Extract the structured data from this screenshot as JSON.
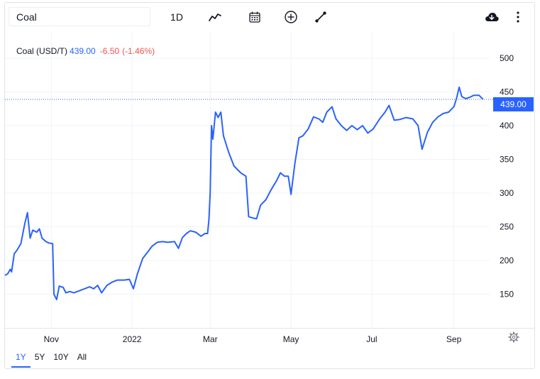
{
  "toolbar": {
    "symbol_value": "Coal",
    "interval_label": "1D",
    "icons": [
      "chart-type-icon",
      "calendar-icon",
      "add-indicator-icon",
      "draw-line-icon",
      "download-icon",
      "more-vertical-icon"
    ]
  },
  "legend": {
    "name": "Coal (USD/T)",
    "price": "439.00",
    "change": "-6.50",
    "change_pct": "(-1.46%)"
  },
  "price_tag": "439.00",
  "range_tabs": [
    {
      "label": "1Y",
      "active": true
    },
    {
      "label": "5Y",
      "active": false
    },
    {
      "label": "10Y",
      "active": false
    },
    {
      "label": "All",
      "active": false
    }
  ],
  "colors": {
    "line": "#2962ff",
    "down": "#ef5350",
    "grid": "#f0f3fa",
    "text": "#131722"
  },
  "chart_data": {
    "type": "line",
    "title": "",
    "xlabel": "",
    "ylabel": "",
    "ylim": [
      100,
      540
    ],
    "yticks": [
      150,
      200,
      250,
      300,
      350,
      400,
      450,
      500
    ],
    "xticks": [
      {
        "label": "Nov",
        "date": "2021-11-01"
      },
      {
        "label": "2022",
        "date": "2022-01-01"
      },
      {
        "label": "Mar",
        "date": "2022-03-01"
      },
      {
        "label": "May",
        "date": "2022-05-01"
      },
      {
        "label": "Jul",
        "date": "2022-07-01"
      },
      {
        "label": "Sep",
        "date": "2022-09-01"
      }
    ],
    "x_start": "2021-09-27",
    "x_end": "2022-09-28",
    "last_value": 439.0,
    "grid": true,
    "series": [
      {
        "values": [
          [
            "2021-09-27",
            178
          ],
          [
            "2021-09-29",
            180
          ],
          [
            "2021-10-01",
            187
          ],
          [
            "2021-10-02",
            183
          ],
          [
            "2021-10-04",
            210
          ],
          [
            "2021-10-06",
            215
          ],
          [
            "2021-10-09",
            225
          ],
          [
            "2021-10-12",
            255
          ],
          [
            "2021-10-14",
            271
          ],
          [
            "2021-10-16",
            233
          ],
          [
            "2021-10-18",
            245
          ],
          [
            "2021-10-21",
            242
          ],
          [
            "2021-10-23",
            247
          ],
          [
            "2021-10-25",
            233
          ],
          [
            "2021-10-28",
            228
          ],
          [
            "2021-10-30",
            226
          ],
          [
            "2021-11-02",
            225
          ],
          [
            "2021-11-03",
            150
          ],
          [
            "2021-11-05",
            142
          ],
          [
            "2021-11-07",
            162
          ],
          [
            "2021-11-10",
            160
          ],
          [
            "2021-11-12",
            152
          ],
          [
            "2021-11-15",
            154
          ],
          [
            "2021-11-18",
            152
          ],
          [
            "2021-11-22",
            155
          ],
          [
            "2021-11-26",
            158
          ],
          [
            "2021-11-30",
            161
          ],
          [
            "2021-12-03",
            158
          ],
          [
            "2021-12-06",
            163
          ],
          [
            "2021-12-09",
            152
          ],
          [
            "2021-12-13",
            163
          ],
          [
            "2021-12-17",
            168
          ],
          [
            "2021-12-21",
            171
          ],
          [
            "2021-12-26",
            171
          ],
          [
            "2021-12-30",
            172
          ],
          [
            "2022-01-02",
            158
          ],
          [
            "2022-01-05",
            180
          ],
          [
            "2022-01-09",
            203
          ],
          [
            "2022-01-13",
            213
          ],
          [
            "2022-01-16",
            221
          ],
          [
            "2022-01-20",
            227
          ],
          [
            "2022-01-24",
            228
          ],
          [
            "2022-01-28",
            227
          ],
          [
            "2022-02-02",
            228
          ],
          [
            "2022-02-05",
            218
          ],
          [
            "2022-02-08",
            234
          ],
          [
            "2022-02-11",
            240
          ],
          [
            "2022-02-14",
            244
          ],
          [
            "2022-02-18",
            242
          ],
          [
            "2022-02-22",
            236
          ],
          [
            "2022-02-25",
            240
          ],
          [
            "2022-02-27",
            240
          ],
          [
            "2022-02-28",
            260
          ],
          [
            "2022-03-01",
            300
          ],
          [
            "2022-03-02",
            400
          ],
          [
            "2022-03-03",
            380
          ],
          [
            "2022-03-05",
            420
          ],
          [
            "2022-03-07",
            412
          ],
          [
            "2022-03-09",
            420
          ],
          [
            "2022-03-11",
            385
          ],
          [
            "2022-03-15",
            360
          ],
          [
            "2022-03-19",
            340
          ],
          [
            "2022-03-24",
            330
          ],
          [
            "2022-03-28",
            325
          ],
          [
            "2022-03-30",
            265
          ],
          [
            "2022-04-02",
            263
          ],
          [
            "2022-04-05",
            262
          ],
          [
            "2022-04-08",
            282
          ],
          [
            "2022-04-12",
            290
          ],
          [
            "2022-04-16",
            305
          ],
          [
            "2022-04-20",
            318
          ],
          [
            "2022-04-23",
            330
          ],
          [
            "2022-04-26",
            325
          ],
          [
            "2022-04-29",
            325
          ],
          [
            "2022-05-01",
            298
          ],
          [
            "2022-05-04",
            345
          ],
          [
            "2022-05-07",
            382
          ],
          [
            "2022-05-10",
            385
          ],
          [
            "2022-05-14",
            395
          ],
          [
            "2022-05-18",
            413
          ],
          [
            "2022-05-22",
            410
          ],
          [
            "2022-05-25",
            405
          ],
          [
            "2022-05-28",
            420
          ],
          [
            "2022-06-01",
            428
          ],
          [
            "2022-06-04",
            410
          ],
          [
            "2022-06-08",
            400
          ],
          [
            "2022-06-12",
            393
          ],
          [
            "2022-06-16",
            400
          ],
          [
            "2022-06-20",
            394
          ],
          [
            "2022-06-24",
            400
          ],
          [
            "2022-06-28",
            389
          ],
          [
            "2022-07-02",
            395
          ],
          [
            "2022-07-07",
            410
          ],
          [
            "2022-07-11",
            420
          ],
          [
            "2022-07-14",
            430
          ],
          [
            "2022-07-18",
            408
          ],
          [
            "2022-07-22",
            409
          ],
          [
            "2022-07-27",
            412
          ],
          [
            "2022-08-01",
            410
          ],
          [
            "2022-08-05",
            400
          ],
          [
            "2022-08-08",
            365
          ],
          [
            "2022-08-12",
            390
          ],
          [
            "2022-08-16",
            405
          ],
          [
            "2022-08-20",
            413
          ],
          [
            "2022-08-24",
            418
          ],
          [
            "2022-08-28",
            420
          ],
          [
            "2022-09-01",
            428
          ],
          [
            "2022-09-03",
            440
          ],
          [
            "2022-09-05",
            457
          ],
          [
            "2022-09-07",
            443
          ],
          [
            "2022-09-10",
            440
          ],
          [
            "2022-09-13",
            442
          ],
          [
            "2022-09-16",
            445
          ],
          [
            "2022-09-20",
            445
          ],
          [
            "2022-09-23",
            439
          ]
        ]
      }
    ]
  }
}
